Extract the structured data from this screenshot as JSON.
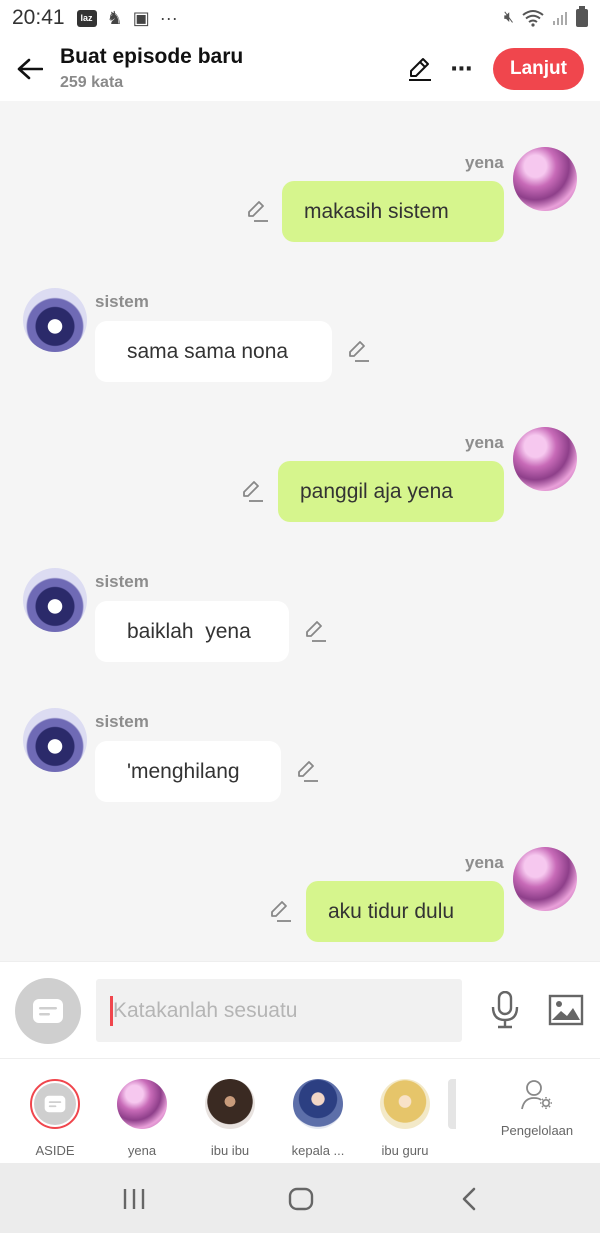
{
  "status_bar": {
    "time": "20:41"
  },
  "header": {
    "title": "Buat episode baru",
    "word_count": "259 kata",
    "next_label": "Lanjut"
  },
  "messages": [
    {
      "speaker": "yena",
      "text": "makasih sistem",
      "side": "right"
    },
    {
      "speaker": "sistem",
      "text": "sama sama nona",
      "side": "left"
    },
    {
      "speaker": "yena",
      "text": "panggil aja yena",
      "side": "right"
    },
    {
      "speaker": "sistem",
      "text": "baiklah  yena",
      "side": "left"
    },
    {
      "speaker": "sistem",
      "text": "'menghilang",
      "side": "left"
    },
    {
      "speaker": "yena",
      "text": "aku tidur dulu",
      "side": "right"
    }
  ],
  "input": {
    "placeholder": "Katakanlah sesuatu"
  },
  "characters": [
    {
      "label": "ASIDE"
    },
    {
      "label": "yena"
    },
    {
      "label": "ibu ibu"
    },
    {
      "label": "kepala ..."
    },
    {
      "label": "ibu guru"
    }
  ],
  "manage_label": "Pengelolaan",
  "colors": {
    "accent": "#f0464d",
    "my_bubble": "#d6f58d",
    "their_bubble": "#ffffff"
  }
}
